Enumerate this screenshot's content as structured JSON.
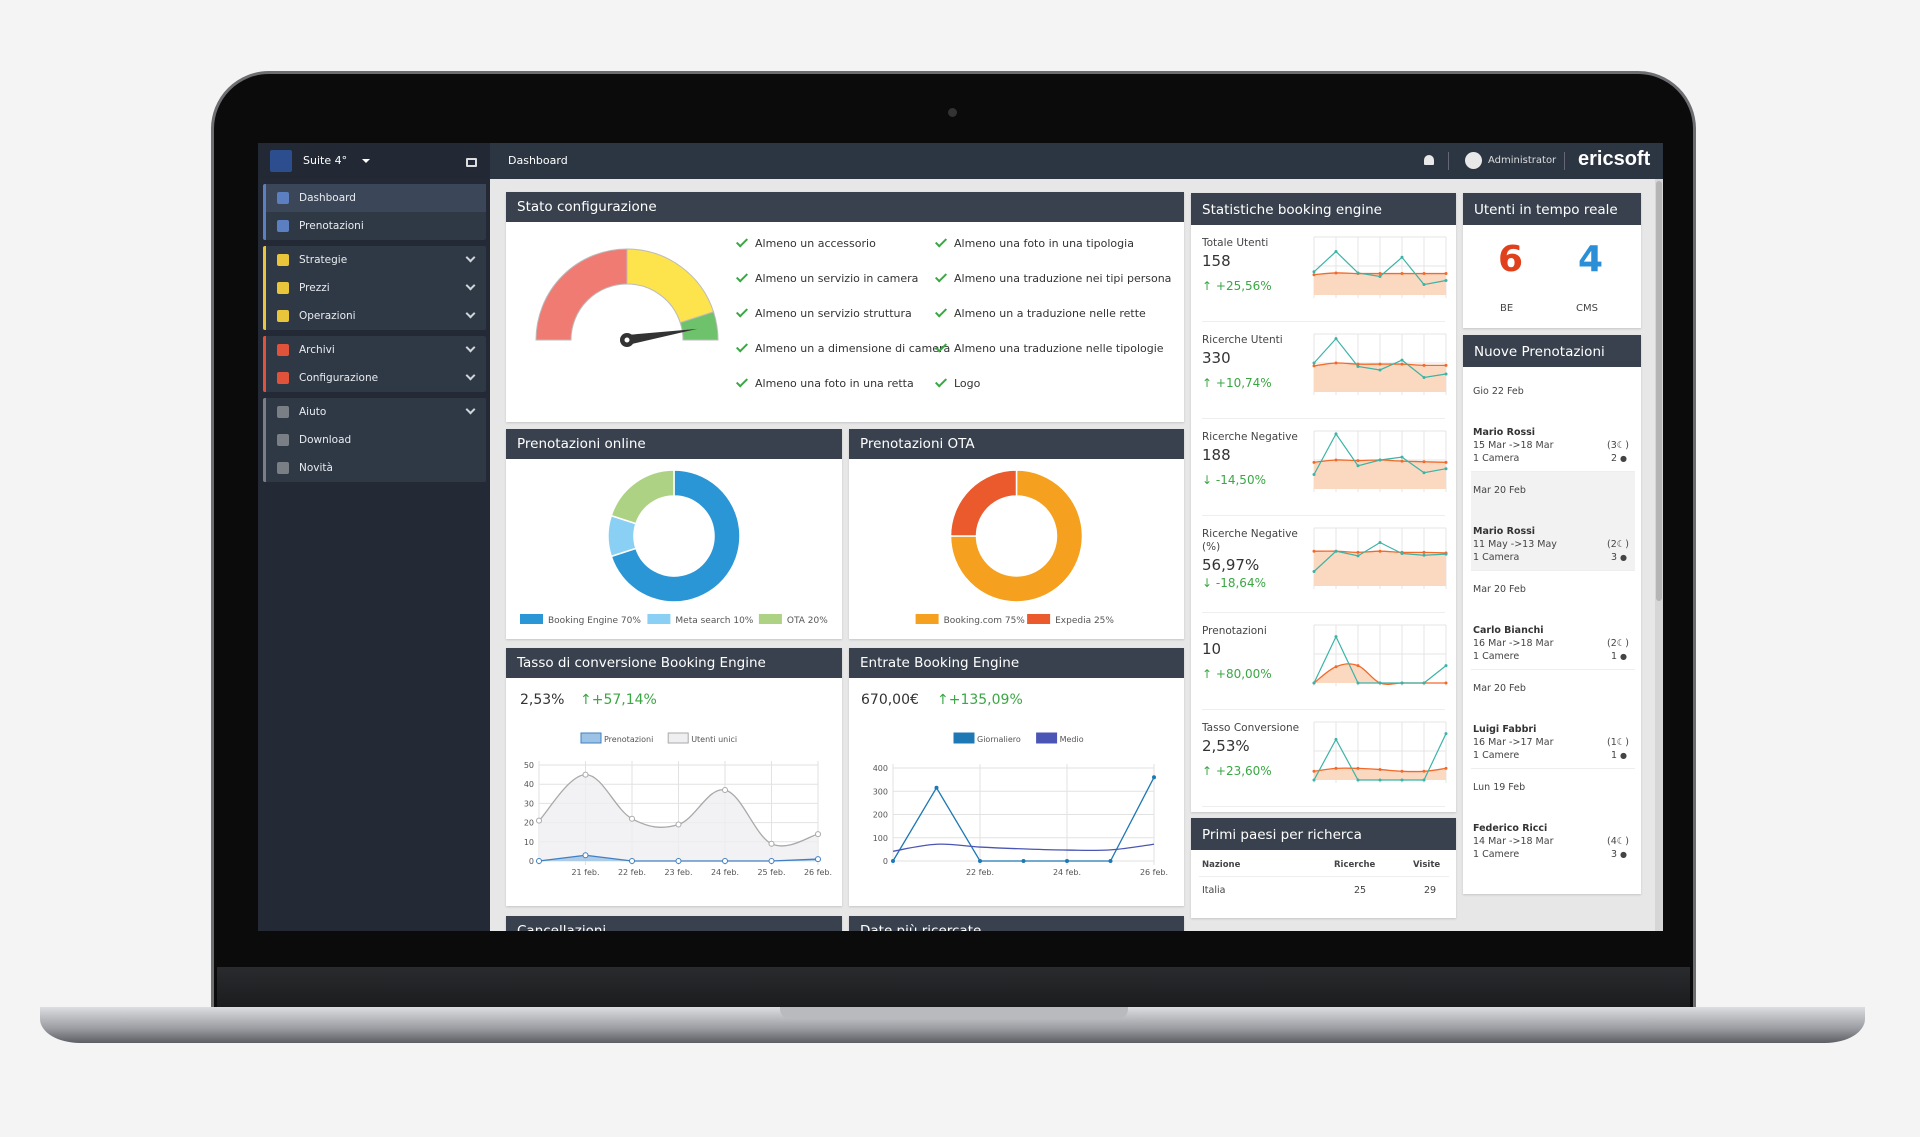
{
  "header": {
    "hotel": "Suite 4°",
    "page_title": "Dashboard",
    "user": "Administrator",
    "brand": "ericsoft"
  },
  "sidebar": {
    "groups": [
      {
        "color": "#5b7fc0",
        "items": [
          {
            "label": "Dashboard",
            "icon": "dashboard-icon",
            "active": true
          },
          {
            "label": "Prenotazioni",
            "icon": "book-icon"
          }
        ]
      },
      {
        "color": "#e8c53a",
        "items": [
          {
            "label": "Strategie",
            "icon": "calendar-icon",
            "chevron": true
          },
          {
            "label": "Prezzi",
            "icon": "briefcase-icon",
            "chevron": true
          },
          {
            "label": "Operazioni",
            "icon": "toolbox-icon",
            "chevron": true
          }
        ]
      },
      {
        "color": "#e0533a",
        "items": [
          {
            "label": "Archivi",
            "icon": "puzzle-icon",
            "chevron": true
          },
          {
            "label": "Configurazione",
            "icon": "gear-icon",
            "chevron": true
          }
        ]
      },
      {
        "color": "#7a7f86",
        "items": [
          {
            "label": "Aiuto",
            "icon": "help-icon",
            "chevron": true
          },
          {
            "label": "Download",
            "icon": "cloud-download-icon"
          },
          {
            "label": "Novità",
            "icon": "news-icon"
          }
        ]
      }
    ]
  },
  "stato": {
    "title": "Stato configurazione",
    "gauge_value": 0.95,
    "gauge_bands": [
      {
        "to": 0.5,
        "color": "#f07b72"
      },
      {
        "to": 0.9,
        "color": "#fde44c"
      },
      {
        "to": 1,
        "color": "#6dc26b"
      }
    ],
    "checks": [
      "Almeno un accessorio",
      "Almeno un servizio in camera",
      "Almeno un servizio struttura",
      "Almeno un a dimensione di camera",
      "Almeno una foto in una retta",
      "Almeno una foto in una tipologia",
      "Almeno una traduzione nei tipi persona",
      "Almeno un a traduzione nelle rette",
      "Almeno una traduzione nelle tipologie",
      "Logo"
    ]
  },
  "online": {
    "title": "Prenotazioni online"
  },
  "ota": {
    "title": "Prenotazioni OTA"
  },
  "tasso": {
    "title": "Tasso di conversione Booking Engine",
    "value": "2,53%",
    "change": "+57,14%"
  },
  "entrate": {
    "title": "Entrate Booking Engine",
    "value": "670,00€",
    "change": "+135,09%"
  },
  "bottom": {
    "left_title": "Cancellazioni",
    "right_title": "Date più ricercate"
  },
  "stats": {
    "title": "Statistiche booking engine",
    "rows": [
      {
        "label": "Totale Utenti",
        "value": "158",
        "change": "+25,56%",
        "dir": "up",
        "teal": [
          40,
          75,
          38,
          32,
          65,
          18,
          25
        ],
        "orange": [
          35,
          38,
          37,
          37,
          37,
          37,
          37
        ]
      },
      {
        "label": "Ricerche Utenti",
        "value": "330",
        "change": "+10,74%",
        "dir": "up",
        "teal": [
          50,
          92,
          44,
          38,
          55,
          25,
          31
        ],
        "orange": [
          45,
          50,
          48,
          48,
          48,
          46,
          46
        ]
      },
      {
        "label": "Ricerche Negative",
        "value": "188",
        "change": "-14,50%",
        "dir": "down",
        "teal": [
          25,
          95,
          40,
          50,
          55,
          28,
          35
        ],
        "orange": [
          46,
          50,
          49,
          50,
          48,
          47,
          46
        ]
      },
      {
        "label": "Ricerche Negative (%)",
        "value": "56,97%",
        "change": "-18,64%",
        "dir": "down",
        "teal": [
          25,
          60,
          52,
          75,
          56,
          53,
          55
        ],
        "orange": [
          60,
          60,
          58,
          60,
          58,
          58,
          57
        ]
      },
      {
        "label": "Prenotazioni",
        "value": "10",
        "change": "+80,00%",
        "dir": "up",
        "teal": [
          0,
          80,
          0,
          0,
          0,
          0,
          30
        ],
        "orange": [
          0,
          28,
          30,
          0,
          0,
          0,
          0
        ]
      },
      {
        "label": "Tasso Conversione",
        "value": "2,53%",
        "change": "+23,60%",
        "dir": "up",
        "teal": [
          0,
          70,
          0,
          0,
          0,
          0,
          80
        ],
        "orange": [
          15,
          20,
          20,
          18,
          15,
          15,
          20
        ]
      }
    ]
  },
  "paesi": {
    "title": "Primi paesi per richerca",
    "columns": [
      "Nazione",
      "Ricerche",
      "Visite"
    ],
    "rows": [
      [
        "Italia",
        "25",
        "29"
      ]
    ]
  },
  "realtime": {
    "title": "Utenti in tempo reale",
    "be_value": "6",
    "be_label": "BE",
    "cms_value": "4",
    "cms_label": "CMS"
  },
  "nuove": {
    "title": "Nuove Prenotazioni",
    "entries": [
      {
        "date": "Gio 22 Feb",
        "name": "Mario Rossi",
        "dates": "15 Mar ->18 Mar",
        "rooms": "1 Camera",
        "nights": "(3",
        "persons": "2"
      },
      {
        "date": "Mar 20 Feb",
        "name": "Mario Rossi",
        "dates": "11 May ->13 May",
        "rooms": "1 Camera",
        "nights": "(2",
        "persons": "3",
        "highlight": true
      },
      {
        "date": "Mar 20 Feb",
        "name": "Carlo Bianchi",
        "dates": "16 Mar ->18 Mar",
        "rooms": "1 Camere",
        "nights": "(2",
        "persons": "1"
      },
      {
        "date": "Mar 20 Feb",
        "name": "Luigi Fabbri",
        "dates": "16 Mar ->17 Mar",
        "rooms": "1 Camere",
        "nights": "(1",
        "persons": "1"
      },
      {
        "date": "Lun 19 Feb",
        "name": "Federico Ricci",
        "dates": "14 Mar ->18 Mar",
        "rooms": "1 Camere",
        "nights": "(4",
        "persons": "3"
      }
    ]
  },
  "chart_data": [
    {
      "type": "pie",
      "id": "online",
      "labels": [
        "Booking Engine 70%",
        "Meta search 10%",
        "OTA 20%"
      ],
      "values": [
        70,
        10,
        20
      ],
      "colors": [
        "#2b96d6",
        "#8ad0f5",
        "#aed283"
      ],
      "legend": "bottom"
    },
    {
      "type": "pie",
      "id": "ota",
      "labels": [
        "Booking.com 75%",
        "Expedia 25%"
      ],
      "values": [
        75,
        25
      ],
      "colors": [
        "#f5a01e",
        "#ea5a2d"
      ],
      "legend": "bottom"
    },
    {
      "type": "line",
      "id": "tasso",
      "x": [
        "",
        "21 feb.",
        "22 feb.",
        "23 feb.",
        "24 feb.",
        "25 feb.",
        "26 feb."
      ],
      "ylim": [
        0,
        50
      ],
      "yticks": [
        0,
        10,
        20,
        30,
        40,
        50
      ],
      "grid": true,
      "legend": "top",
      "series": [
        {
          "name": "Prenotazioni",
          "values": [
            0,
            3,
            0,
            0,
            0,
            0,
            1
          ],
          "color": "#3f7fc2"
        },
        {
          "name": "Utenti unici",
          "values": [
            21,
            45,
            22,
            19,
            37,
            9,
            14
          ],
          "color": "#a9a9a9"
        }
      ]
    },
    {
      "type": "line",
      "id": "entrate",
      "x": [
        "",
        "",
        "22 feb.",
        "",
        "24 feb.",
        "",
        "26 feb."
      ],
      "ylim": [
        0,
        400
      ],
      "yticks": [
        0,
        100,
        200,
        300,
        400
      ],
      "grid": true,
      "legend": "top",
      "series": [
        {
          "name": "Giornaliero",
          "values": [
            0,
            315,
            0,
            0,
            0,
            0,
            360
          ],
          "color": "#1e78b4"
        },
        {
          "name": "Medio",
          "values": [
            42,
            72,
            60,
            52,
            47,
            48,
            72
          ],
          "color": "#4a55b5"
        }
      ]
    }
  ]
}
